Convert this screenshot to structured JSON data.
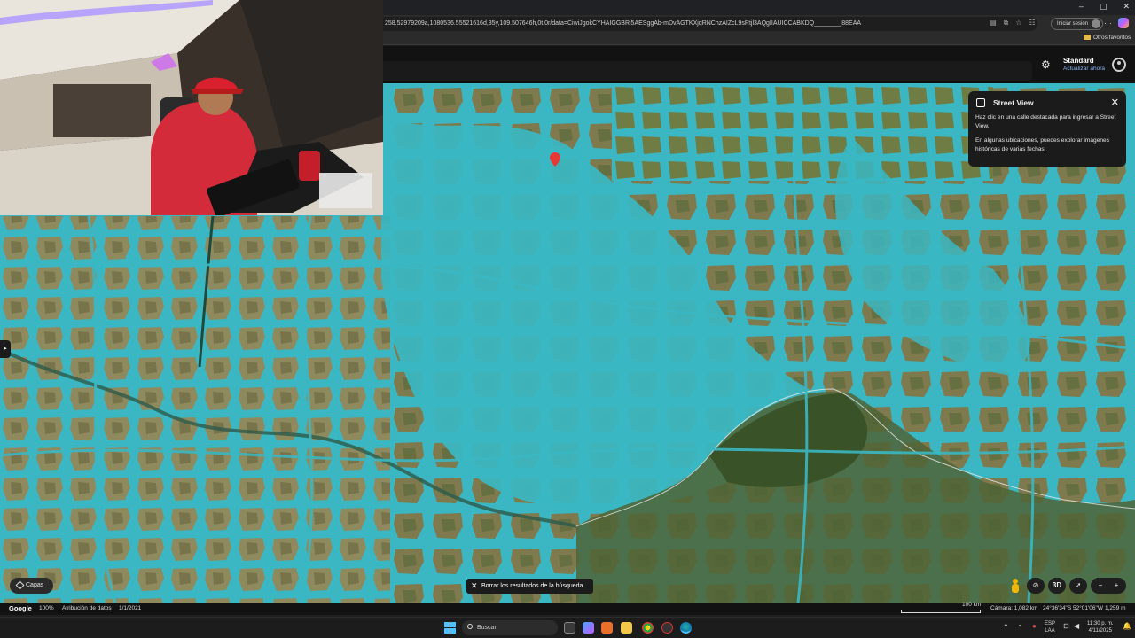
{
  "browser": {
    "url": "258.52979209a,1080536.55521616d,35y,109.507646h,0t,0r/data=CiwiJgokCYHAIGGBRi5AESggAb-mDvAGTKXjqRNChzAIZcL9sRtjl3AQgIIAUICCABKDQ________88EAA",
    "sign_in_label": "Iniciar sesión",
    "favorites_label": "Otros favoritos",
    "window_controls": [
      "–",
      "▢",
      "✕"
    ]
  },
  "maps_header": {
    "plan_title": "Standard",
    "plan_link": "Actualizar ahora"
  },
  "street_view": {
    "title": "Street View",
    "line1": "Haz clic en una calle destacada para ingresar a Street View.",
    "line2": "En algunas ubicaciones, puedes explorar imágenes históricas de varias fechas."
  },
  "map_controls": {
    "layers": "Capas",
    "clear_search": "Borrar los resultados de la búsqueda",
    "mode_3d": "3D",
    "zoom_out": "−",
    "zoom_in": "+"
  },
  "statusbar": {
    "brand": "Google",
    "zoom": "100%",
    "attribution": "Atribución de datos",
    "date": "1/1/2021",
    "scale": "100 km",
    "camera": "Cámara: 1,082 km",
    "coords": "24°36'34\"S 52°01'06\"W",
    "elevation": "1,259 m"
  },
  "taskbar": {
    "search_placeholder": "Buscar",
    "lang_top": "ESP",
    "lang_bottom": "LAA",
    "time": "11:30 p. m.",
    "date": "4/11/2025"
  },
  "colors": {
    "streetview_overlay": "#3ab7c3",
    "accent_link": "#8ab4f8",
    "pin": "#e53935"
  }
}
